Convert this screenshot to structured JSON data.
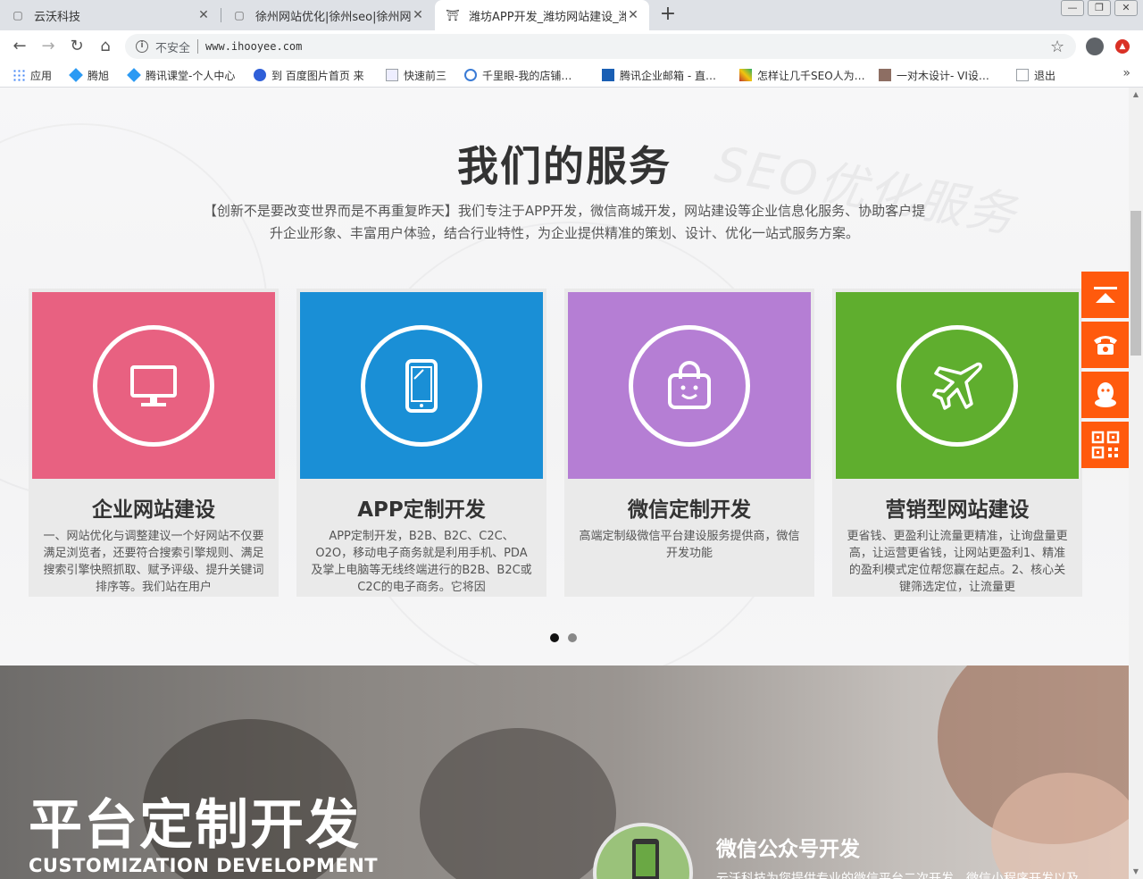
{
  "browser": {
    "tabs": [
      {
        "title": "云沃科技",
        "close": "✕"
      },
      {
        "title": "徐州网站优化|徐州seo|徐州网站",
        "close": "✕"
      },
      {
        "title": "潍坊APP开发_潍坊网站建设_潍坊",
        "close": "✕"
      }
    ],
    "new_tab": "+",
    "window_controls": [
      "—",
      "❐",
      "✕"
    ],
    "security_label": "不安全",
    "url": "www.ihooyee.com"
  },
  "bookmarks": [
    {
      "label": "应用",
      "color": "#4285f4"
    },
    {
      "label": "腾旭",
      "color": "#2b9af3"
    },
    {
      "label": "腾讯课堂-个人中心",
      "color": "#2b9af3"
    },
    {
      "label": "到 百度图片首页 来",
      "color": "#2f5fd8"
    },
    {
      "label": "快速前三",
      "color": "#9aa0a6"
    },
    {
      "label": "千里眼-我的店铺…",
      "color": "#3a7bd5"
    },
    {
      "label": "腾讯企业邮箱 - 直…",
      "color": "#1a5fb4"
    },
    {
      "label": "怎样让几千SEO人为…",
      "color": "#c0392b"
    },
    {
      "label": "一对木设计- VI设…",
      "color": "#8d6e63"
    },
    {
      "label": "退出",
      "color": "#9aa0a6"
    }
  ],
  "bookmarks_more": "»",
  "services": {
    "deco_text": "SEO优化服务",
    "title": "我们的服务",
    "description": "【创新不是要改变世界而是不再重复昨天】我们专注于APP开发，微信商城开发，网站建设等企业信息化服务、协助客户提升企业形象、丰富用户体验，结合行业特性，为企业提供精准的策划、设计、优化一站式服务方案。",
    "cards": [
      {
        "title": "企业网站建设",
        "icon": "monitor-icon",
        "color": "#e86181",
        "text": "一、网站优化与调整建议一个好网站不仅要满足浏览者，还要符合搜索引擎规则、满足搜索引擎快照抓取、赋予评级、提升关键词排序等。我们站在用户"
      },
      {
        "title": "APP定制开发",
        "icon": "phone-icon",
        "color": "#1a8fd6",
        "text": "APP定制开发，B2B、B2C、C2C、O2O，移动电子商务就是利用手机、PDA及掌上电脑等无线终端进行的B2B、B2C或C2C的电子商务。它将因"
      },
      {
        "title": "微信定制开发",
        "icon": "shopping-bag-icon",
        "color": "#b57ed4",
        "text": "高端定制级微信平台建设服务提供商，微信开发功能"
      },
      {
        "title": "营销型网站建设",
        "icon": "airplane-icon",
        "color": "#5fae2e",
        "text": "更省钱、更盈利让流量更精准，让询盘量更高，让运营更省钱，让网站更盈利1、精准的盈利模式定位帮您赢在起点。2、核心关键筛选定位，让流量更"
      }
    ]
  },
  "banner": {
    "title": "平台定制开发",
    "subtitle": "CUSTOMIZATION DEVELOPMENT",
    "heading": "微信公众号开发",
    "text": "云沃科技为您提供专业的微信平台二次开发，微信小程序开发以及"
  },
  "floatbar": [
    "back-to-top-icon",
    "telephone-icon",
    "qq-icon",
    "qrcode-icon"
  ],
  "accent_color": "#ff5a0d"
}
